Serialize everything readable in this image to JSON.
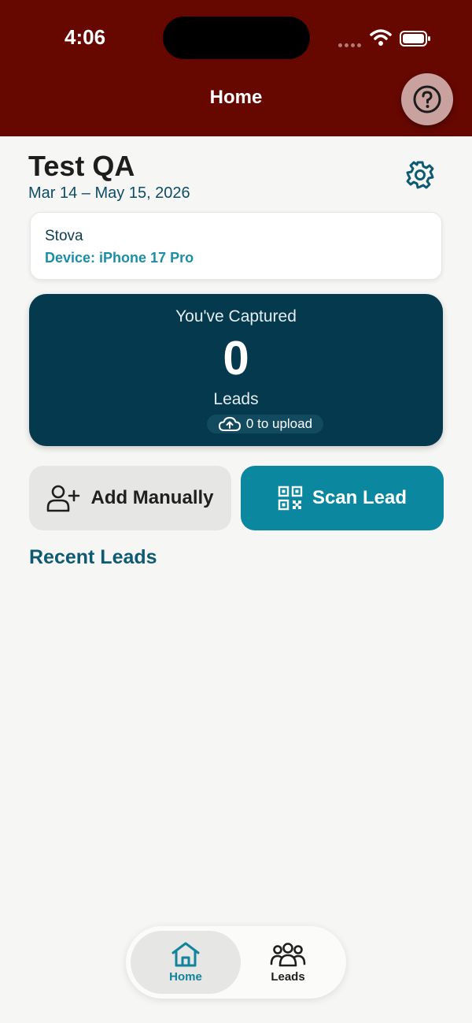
{
  "status_bar": {
    "time": "4:06",
    "icons": [
      "cellular-icon",
      "wifi-icon",
      "battery-icon"
    ]
  },
  "header": {
    "title": "Home",
    "help_icon": "question-circle-icon"
  },
  "event": {
    "title": "Test QA",
    "dates": "Mar 14 – May 15, 2026",
    "settings_icon": "gear-icon"
  },
  "org_card": {
    "name": "Stova",
    "device": "Device: iPhone 17 Pro"
  },
  "captured": {
    "label": "You've Captured",
    "count": "0",
    "unit": "Leads",
    "upload": "0 to upload",
    "upload_icon": "cloud-upload-icon"
  },
  "actions": {
    "add_manually": "Add Manually",
    "add_icon": "add-user-icon",
    "scan_lead": "Scan Lead",
    "scan_icon": "qr-code-icon"
  },
  "recent": {
    "title": "Recent Leads"
  },
  "tabbar": {
    "home": "Home",
    "leads": "Leads"
  },
  "colors": {
    "header_bg": "#660800",
    "card_bg": "#053a4e",
    "accent": "#0b879f",
    "title_teal": "#0d5a72"
  }
}
